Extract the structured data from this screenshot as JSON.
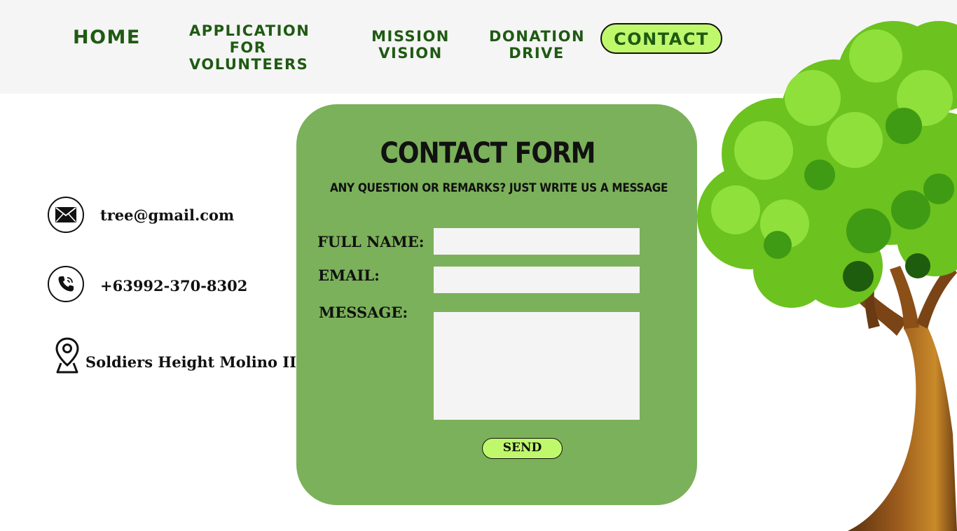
{
  "nav": {
    "home": "HOME",
    "application": "APPLICATION\nFOR\nVOLUNTEERS",
    "mission": "MISSION\nVISION",
    "donation": "DONATION\nDRIVE",
    "contact": "CONTACT"
  },
  "info": {
    "email": "tree@gmail.com",
    "phone": "+63992-370-8302",
    "address": "Soldiers Height Molino III"
  },
  "form": {
    "title": "CONTACT FORM",
    "subtitle": "ANY QUESTION OR REMARKS? JUST WRITE US A MESSAGE",
    "full_name_label": "FULL NAME:",
    "email_label": "EMAIL:",
    "message_label": "MESSAGE:",
    "full_name_value": "",
    "email_value": "",
    "message_value": "",
    "send_label": "SEND"
  },
  "icons": {
    "email": "envelope-icon",
    "phone": "phone-icon",
    "address": "location-pin-icon"
  },
  "colors": {
    "nav_bg": "#f5f5f5",
    "nav_text": "#1f5a12",
    "accent_button": "#c0f86c",
    "card_bg": "#7bb15a",
    "input_bg": "#f4f4f4"
  }
}
